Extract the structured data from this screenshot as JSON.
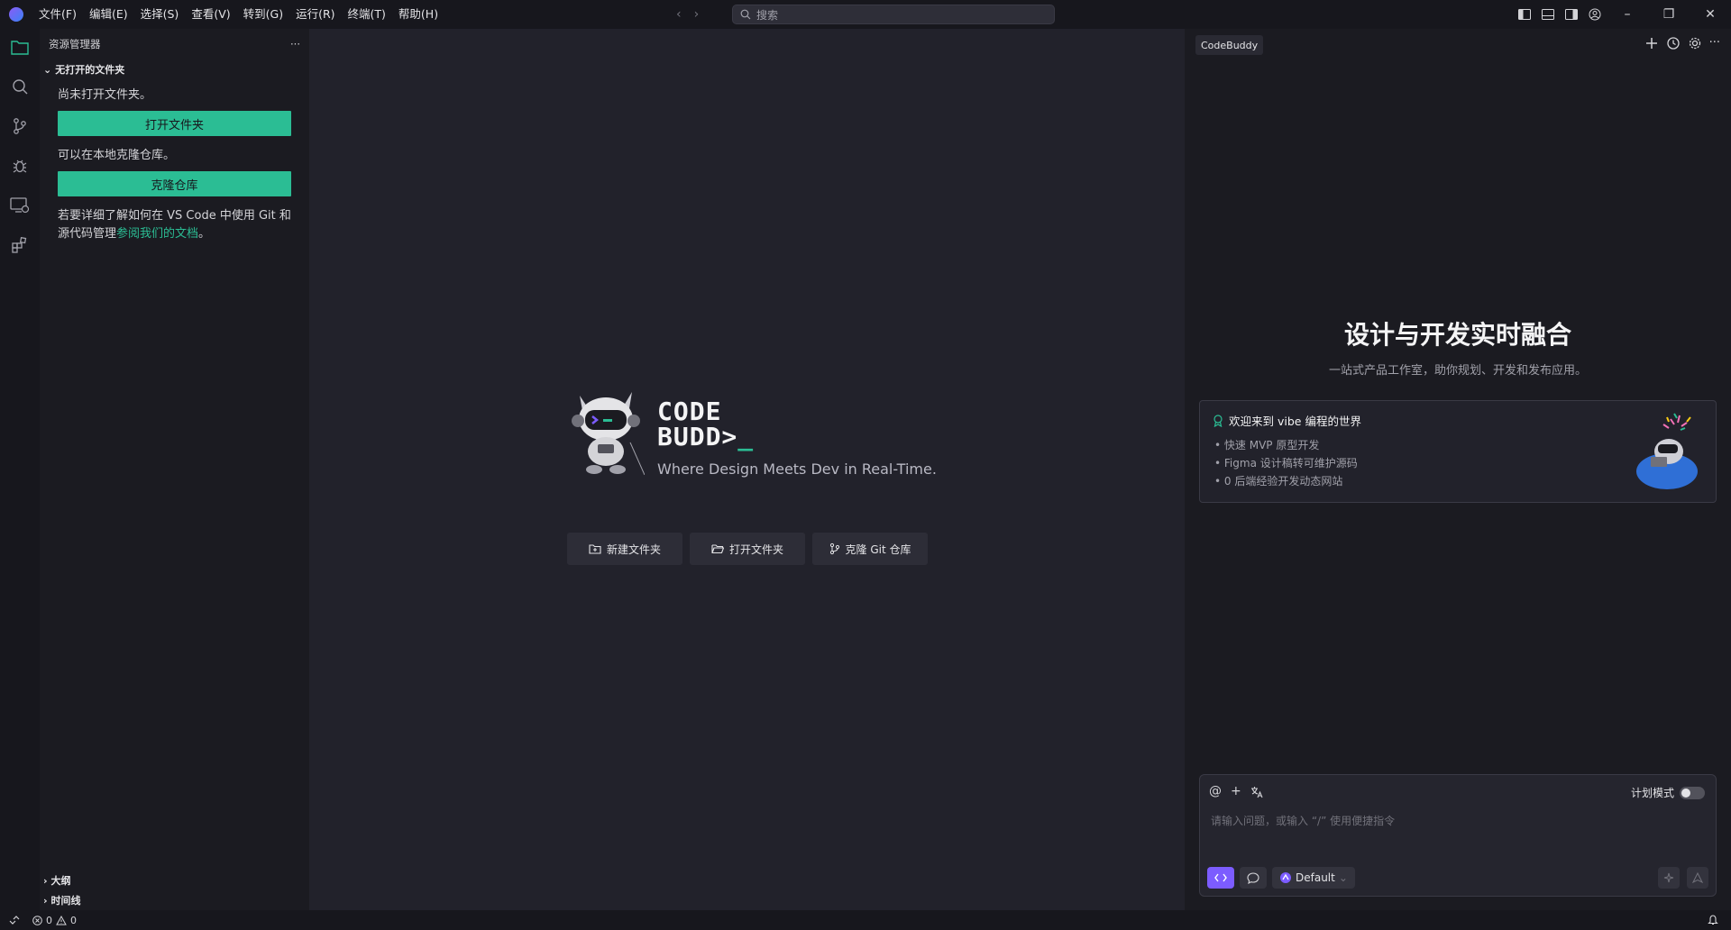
{
  "titlebar": {
    "menu": [
      "文件(F)",
      "编辑(E)",
      "选择(S)",
      "查看(V)",
      "转到(G)",
      "运行(R)",
      "终端(T)",
      "帮助(H)"
    ],
    "search_placeholder": "搜索"
  },
  "sidebar": {
    "title": "资源管理器",
    "section_title": "无打开的文件夹",
    "no_folder_text": "尚未打开文件夹。",
    "open_folder_button": "打开文件夹",
    "clone_text": "可以在本地克隆仓库。",
    "clone_button": "克隆仓库",
    "git_help_text": "若要详细了解如何在 VS Code 中使用 Git 和源代码管理",
    "git_help_link": "参阅我们的文档",
    "git_help_suffix": "。",
    "outline_label": "大纲",
    "timeline_label": "时间线"
  },
  "editor": {
    "brand_line1": "CODE",
    "brand_line2": "BUDD>",
    "brand_cursor": "_",
    "tagline": "Where Design Meets Dev in Real-Time.",
    "actions": [
      {
        "label": "新建文件夹",
        "icon": "new-folder-icon"
      },
      {
        "label": "打开文件夹",
        "icon": "open-folder-icon"
      },
      {
        "label": "克隆 Git 仓库",
        "icon": "git-branch-icon"
      }
    ]
  },
  "panel": {
    "tab_label": "CodeBuddy",
    "hero_title": "设计与开发实时融合",
    "hero_subtitle": "一站式产品工作室，助你规划、开发和发布应用。",
    "vibe": {
      "title": "欢迎来到 vibe 编程的世界",
      "items": [
        "快速 MVP 原型开发",
        "Figma 设计稿转可维护源码",
        "0 后端经验开发动态网站"
      ]
    },
    "chat": {
      "plan_mode_label": "计划模式",
      "plan_mode_on": false,
      "placeholder": "请输入问题，或输入 “/” 使用便捷指令",
      "model": "Default"
    }
  },
  "statusbar": {
    "errors": "0",
    "warnings": "0"
  },
  "colors": {
    "accent_green": "#2bbd94",
    "accent_purple": "#7c5cff",
    "background": "#22222b",
    "sidebar_bg": "#1b1b21"
  }
}
